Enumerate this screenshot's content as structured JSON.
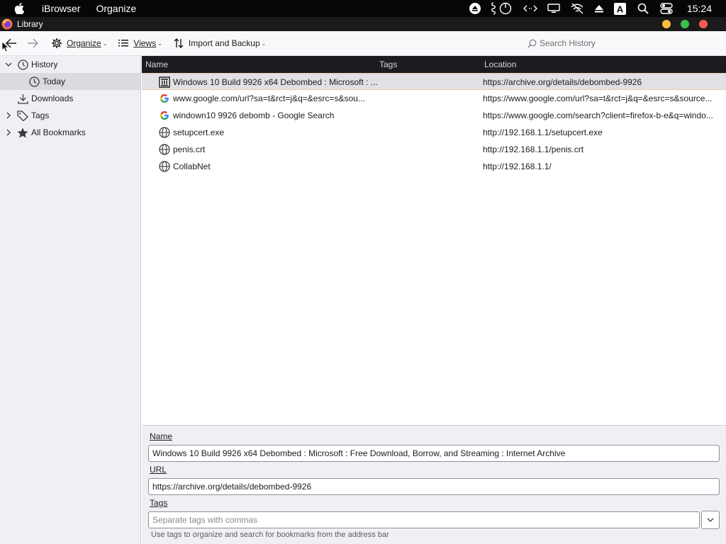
{
  "menubar": {
    "app_name": "iBrowser",
    "menu_items": [
      "Organize"
    ],
    "clock": "15:24",
    "tray_letter": "A"
  },
  "window": {
    "title": "Library"
  },
  "toolbar": {
    "organize_label": "Organize",
    "views_label": "Views",
    "import_backup_label": "Import and Backup",
    "search_placeholder": "Search History"
  },
  "sidebar": {
    "items": [
      {
        "label": "History",
        "icon": "clock-icon",
        "expanded": true
      },
      {
        "label": "Today",
        "icon": "clock-icon",
        "selected": true
      },
      {
        "label": "Downloads",
        "icon": "download-icon"
      },
      {
        "label": "Tags",
        "icon": "tag-icon",
        "expanded": false
      },
      {
        "label": "All Bookmarks",
        "icon": "star-icon",
        "expanded": false
      }
    ]
  },
  "table": {
    "columns": {
      "name": "Name",
      "tags": "Tags",
      "location": "Location"
    },
    "rows": [
      {
        "name": "Windows 10 Build 9926 x64 Debombed : Microsoft : ...",
        "location": "https://archive.org/details/debombed-9926",
        "icon": "archive-icon",
        "selected": true
      },
      {
        "name": "www.google.com/url?sa=t&rct=j&q=&esrc=s&sou...",
        "location": "https://www.google.com/url?sa=t&rct=j&q=&esrc=s&source...",
        "icon": "google-icon"
      },
      {
        "name": "windown10 9926 debomb - Google Search",
        "location": "https://www.google.com/search?client=firefox-b-e&q=windo...",
        "icon": "google-icon"
      },
      {
        "name": "setupcert.exe",
        "location": "http://192.168.1.1/setupcert.exe",
        "icon": "globe-icon"
      },
      {
        "name": "penis.crt",
        "location": "http://192.168.1.1/penis.crt",
        "icon": "globe-icon"
      },
      {
        "name": "CollabNet",
        "location": "http://192.168.1.1/",
        "icon": "globe-icon"
      }
    ]
  },
  "details": {
    "name_label": "Name",
    "name_value": "Windows 10 Build 9926 x64 Debombed : Microsoft : Free Download, Borrow, and Streaming : Internet Archive",
    "url_label": "URL",
    "url_value": "https://archive.org/details/debombed-9926",
    "tags_label": "Tags",
    "tags_placeholder": "Separate tags with commas",
    "hint": "Use tags to organize and search for bookmarks from the address bar"
  }
}
